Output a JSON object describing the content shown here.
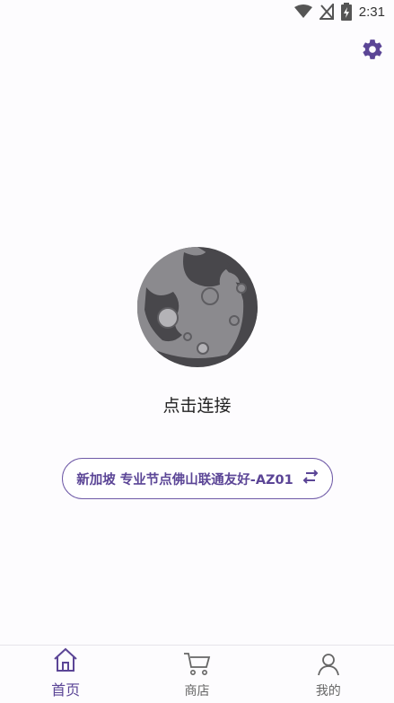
{
  "status_bar": {
    "time": "2:31",
    "icons": [
      "wifi-icon",
      "no-signal-icon",
      "battery-charging-icon"
    ]
  },
  "header": {
    "settings_icon": "gear-icon"
  },
  "main": {
    "connect_label": "点击连接",
    "node_name": "新加坡 专业节点佛山联通友好-AZ01",
    "switch_icon": "swap-arrows-icon"
  },
  "tab_bar": {
    "tabs": [
      {
        "label": "首页",
        "icon": "home-icon",
        "active": true
      },
      {
        "label": "商店",
        "icon": "cart-icon",
        "active": false
      },
      {
        "label": "我的",
        "icon": "user-icon",
        "active": false
      }
    ]
  },
  "colors": {
    "accent": "#5b4596",
    "moon_dark": "#4a494d",
    "moon_light": "#8a898d",
    "background": "#fdfcfe"
  }
}
